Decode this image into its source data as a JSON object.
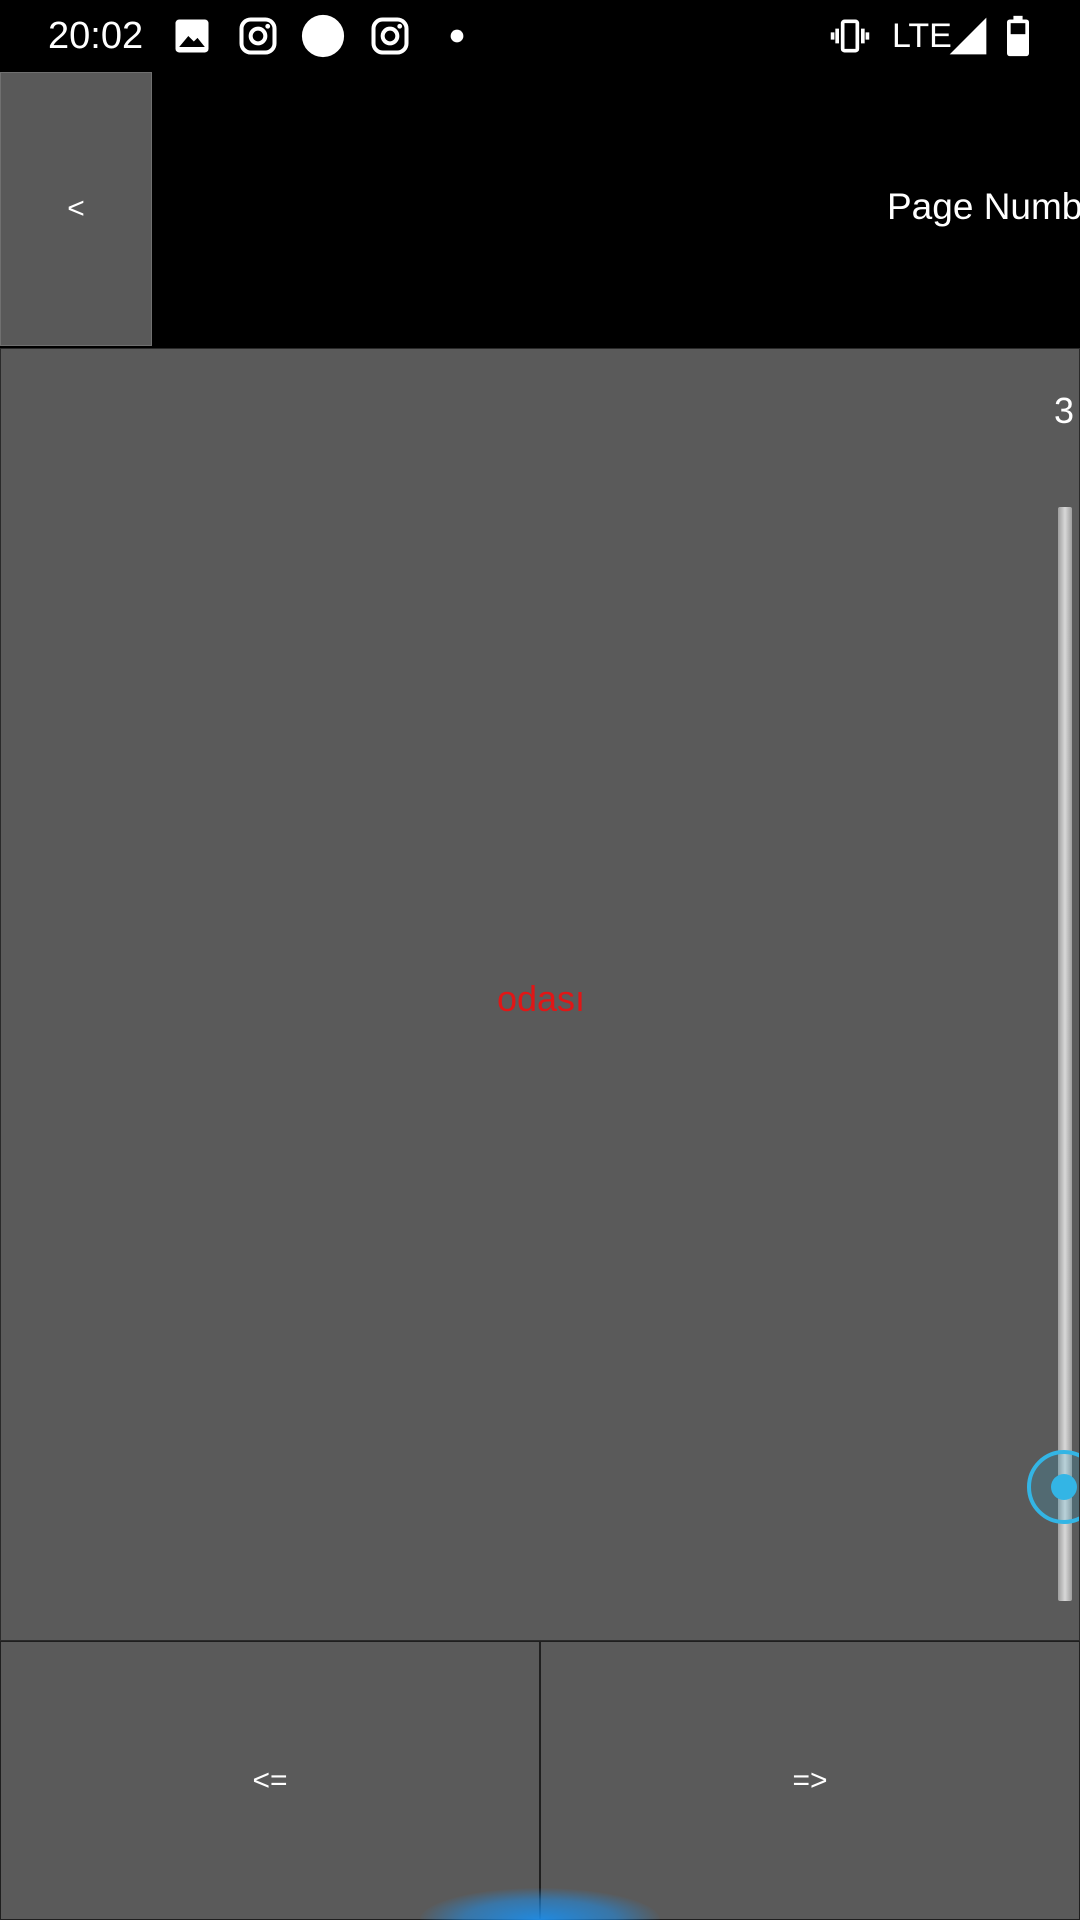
{
  "status_bar": {
    "time": "20:02",
    "network": "LTE",
    "icons": [
      "image-icon",
      "instagram-icon",
      "circle-icon",
      "instagram-icon",
      "dot-icon",
      "vibrate-icon",
      "signal-icon",
      "battery-icon"
    ]
  },
  "toolbar": {
    "back_label": "<",
    "page_number_label": "Page Numb"
  },
  "content": {
    "page_count": "3",
    "word": "odası",
    "word_color": "#e01616",
    "slider_accent": "#33b5e5"
  },
  "nav": {
    "prev_label": "<=",
    "next_label": "=>"
  }
}
